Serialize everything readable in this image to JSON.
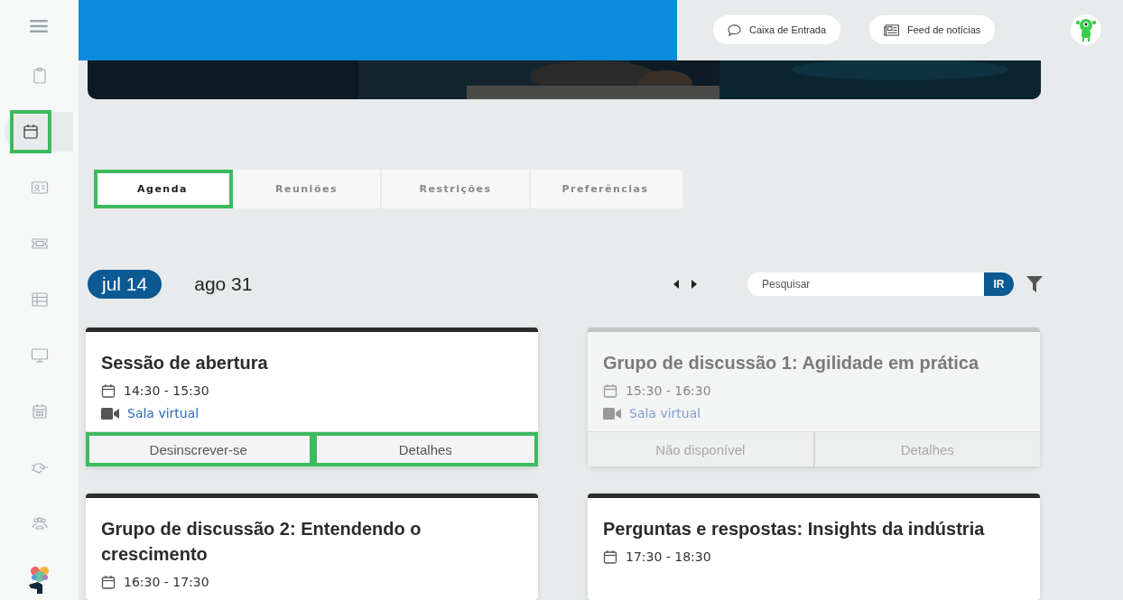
{
  "sidebar": {
    "items": [
      {
        "selected": false,
        "highlighted": false
      },
      {
        "selected": true,
        "highlighted": true
      },
      {
        "selected": false,
        "highlighted": false
      },
      {
        "selected": false,
        "highlighted": false
      },
      {
        "selected": false,
        "highlighted": false
      },
      {
        "selected": false,
        "highlighted": false
      },
      {
        "selected": false,
        "highlighted": false
      },
      {
        "selected": false,
        "highlighted": false
      },
      {
        "selected": false,
        "highlighted": false
      }
    ]
  },
  "header": {
    "buttons": [
      {
        "kind": "chat",
        "label": "Caixa de Entrada"
      },
      {
        "kind": "news",
        "label": "Feed de notícias"
      }
    ]
  },
  "tabs": [
    {
      "label": "Agenda",
      "selected": true,
      "highlighted": true
    },
    {
      "label": "Reuniões",
      "selected": false,
      "highlighted": false
    },
    {
      "label": "Restrições",
      "selected": false,
      "highlighted": false
    },
    {
      "label": "Preferências",
      "selected": false,
      "highlighted": false
    }
  ],
  "dates": [
    {
      "label": "jul 14",
      "selected": true
    },
    {
      "label": "ago 31",
      "selected": false
    }
  ],
  "search": {
    "placeholder": "Pesquisar",
    "button": "IR"
  },
  "sessions": [
    {
      "title": "Sessão de abertura",
      "time": "14:30 - 15:30",
      "room": "Sala virtual",
      "available": true,
      "actions": [
        {
          "label": "Desinscrever-se",
          "highlighted": true
        },
        {
          "label": "Detalhes",
          "highlighted": true
        }
      ]
    },
    {
      "title": "Grupo de discussão 1: Agilidade em prática",
      "time": "15:30 - 16:30",
      "room": "Sala virtual",
      "available": false,
      "actions": [
        {
          "label": "Não disponível",
          "highlighted": false
        },
        {
          "label": "Detalhes",
          "highlighted": false
        }
      ]
    },
    {
      "title": "Grupo de discussão 2: Entendendo o crescimento",
      "time": "16:30 - 17:30",
      "available": true
    },
    {
      "title": "Perguntas e respostas: Insights da indústria",
      "time": "17:30 - 18:30",
      "available": true
    }
  ]
}
